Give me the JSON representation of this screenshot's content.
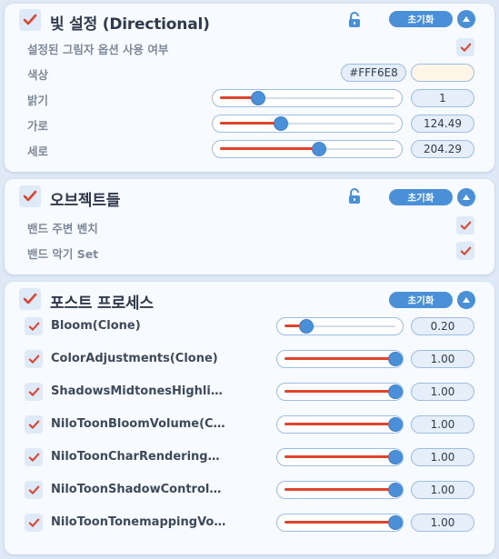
{
  "colors": {
    "accent": "#4a90d9",
    "check": "#e0432c",
    "light_color": "#FFF6E8"
  },
  "light_panel": {
    "title": "빛 설정 (Directional)",
    "reset_label": "초기화",
    "lock_icon": "unlock-icon",
    "shadow_option_label": "설정된 그림자 옵션 사용 여부",
    "color_label": "색상",
    "color_value": "#FFF6E8",
    "brightness_label": "밝기",
    "brightness_value": "1",
    "brightness_fraction": 0.22,
    "horizontal_label": "가로",
    "horizontal_value": "124.49",
    "horizontal_fraction": 0.35,
    "vertical_label": "세로",
    "vertical_value": "204.29",
    "vertical_fraction": 0.57
  },
  "objects_panel": {
    "title": "오브젝트들",
    "reset_label": "초기화",
    "items": [
      {
        "label": "밴드 주변 벤치",
        "checked": true
      },
      {
        "label": "밴드 악기 Set",
        "checked": true
      }
    ]
  },
  "post_panel": {
    "title": "포스트 프로세스",
    "reset_label": "초기화",
    "items": [
      {
        "label": "Bloom(Clone)",
        "value": "0.20",
        "fraction": 0.2
      },
      {
        "label": "ColorAdjustments(Clone)",
        "value": "1.00",
        "fraction": 1.0
      },
      {
        "label": "ShadowsMidtonesHighlig···",
        "value": "1.00",
        "fraction": 1.0
      },
      {
        "label": "NiloToonBloomVolume(Cl···",
        "value": "1.00",
        "fraction": 1.0
      },
      {
        "label": "NiloToonCharRenderingC···",
        "value": "1.00",
        "fraction": 1.0
      },
      {
        "label": "NiloToonShadowControlV···",
        "value": "1.00",
        "fraction": 1.0
      },
      {
        "label": "NiloToonTonemappingVol···",
        "value": "1.00",
        "fraction": 1.0
      }
    ]
  }
}
